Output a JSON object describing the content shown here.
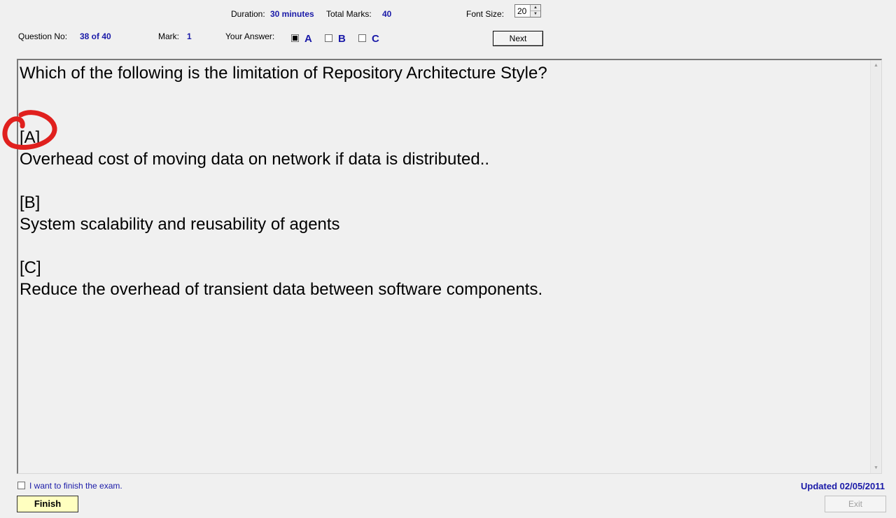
{
  "header": {
    "duration_label": "Duration:",
    "duration_value": "30 minutes",
    "total_marks_label": "Total Marks:",
    "total_marks_value": "40",
    "font_size_label": "Font Size:",
    "font_size_value": "20",
    "question_no_label": "Question No:",
    "question_no_value": "38 of 40",
    "mark_label": "Mark:",
    "mark_value": "1",
    "your_answer_label": "Your Answer:",
    "answers": [
      {
        "letter": "A",
        "checked": true
      },
      {
        "letter": "B",
        "checked": false
      },
      {
        "letter": "C",
        "checked": false
      }
    ],
    "next_label": "Next"
  },
  "question": {
    "text": "Which of the following is the limitation of Repository Architecture Style?",
    "options": [
      {
        "tag": "[A]",
        "text": "Overhead cost of moving data on network if data is distributed.."
      },
      {
        "tag": "[B]",
        "text": "System scalability and reusability of agents"
      },
      {
        "tag": "[C]",
        "text": "Reduce the overhead of transient data between software components."
      }
    ]
  },
  "footer": {
    "finish_checkbox_label": "I want to finish the exam.",
    "updated_label": "Updated 02/05/2011",
    "finish_label": "Finish",
    "exit_label": "Exit"
  },
  "colors": {
    "value_blue": "#1a1aa8",
    "annotation_red": "#e0201e",
    "finish_bg": "#ffffc0"
  }
}
